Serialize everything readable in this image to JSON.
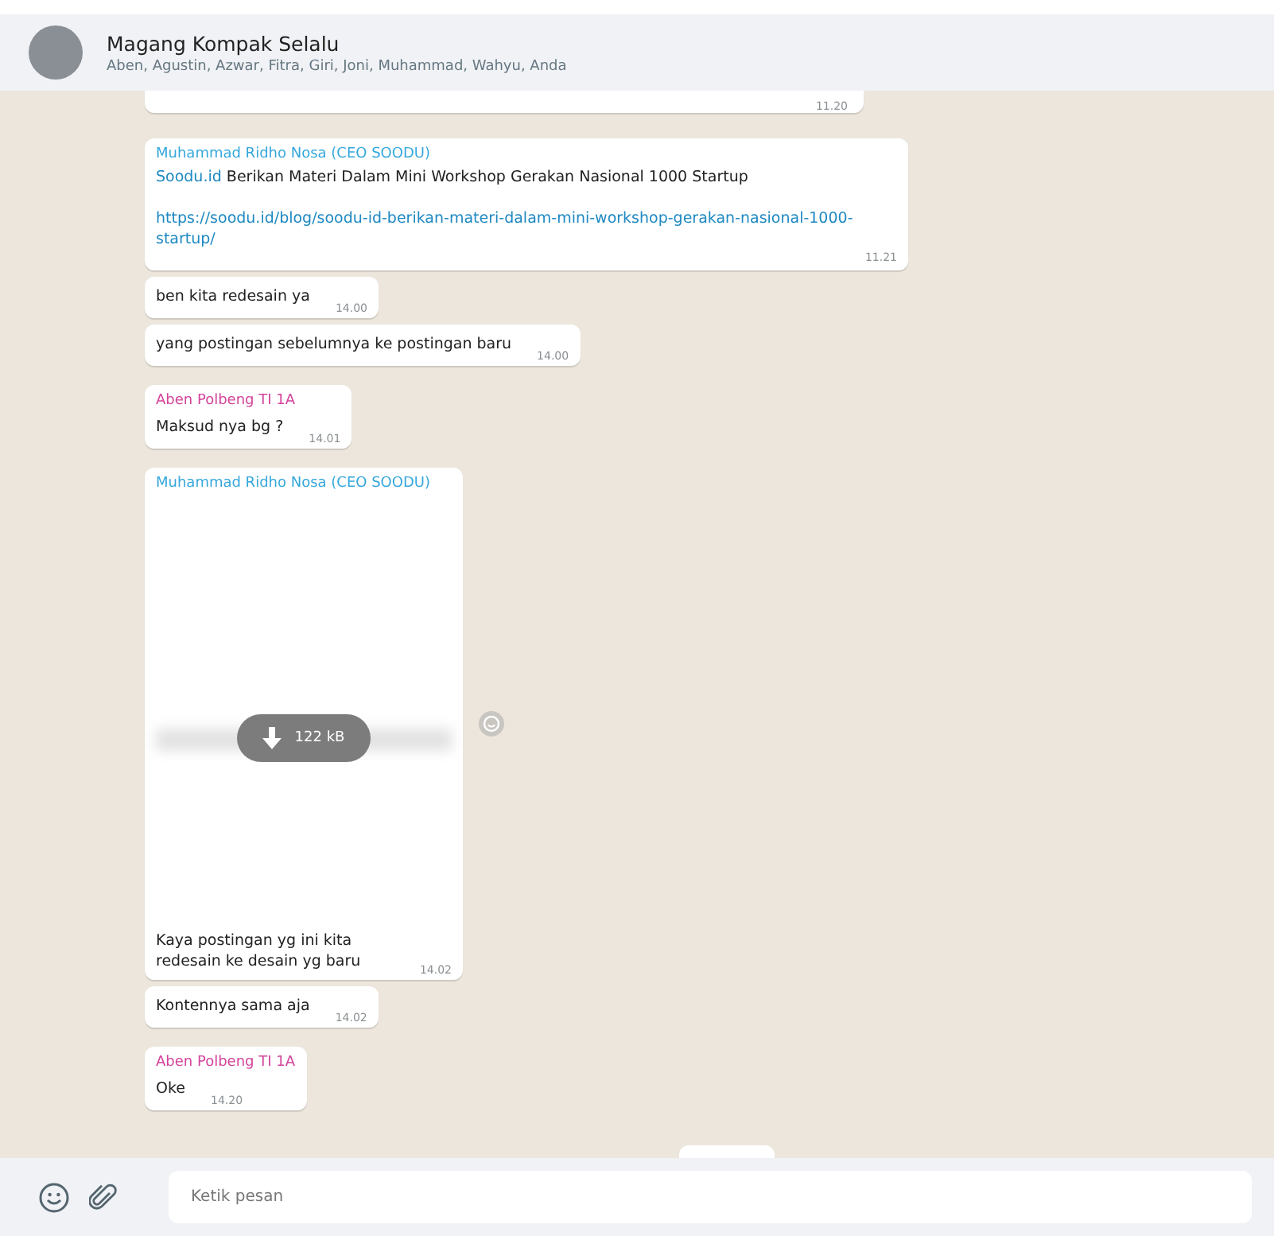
{
  "header": {
    "title": "Magang Kompak Selalu",
    "members": "Aben, Agustin, Azwar, Fitra, Giri, Joni, Muhammad, Wahyu, Anda"
  },
  "messages": [
    {
      "kind": "partial",
      "time": "11.20"
    },
    {
      "kind": "link",
      "sender": "Muhammad Ridho Nosa (CEO SOODU)",
      "color": "#35a7dc",
      "site": "Soodu.id",
      "text": "Berikan Materi Dalam Mini Workshop Gerakan Nasional 1000 Startup",
      "url": "https://soodu.id/blog/soodu-id-berikan-materi-dalam-mini-workshop-gerakan-nasional-1000-startup/",
      "time": "11.21"
    },
    {
      "kind": "text",
      "text": "ben kita redesain ya",
      "time": "14.00"
    },
    {
      "kind": "text",
      "text": "yang postingan sebelumnya ke postingan baru",
      "time": "14.00"
    },
    {
      "kind": "text",
      "sender": "Aben Polbeng TI 1A",
      "color": "#d3439a",
      "text": "Maksud nya bg ?",
      "time": "14.01"
    },
    {
      "kind": "document",
      "sender": "Muhammad Ridho Nosa (CEO SOODU)",
      "color": "#35a7dc",
      "size": "122 kB",
      "text": "Kaya postingan yg ini kita redesain ke desain yg baru",
      "time": "14.02"
    },
    {
      "kind": "text",
      "text": "Kontennya sama aja",
      "time": "14.02"
    },
    {
      "kind": "text",
      "sender": "Aben Polbeng TI 1A",
      "color": "#d3439a",
      "text": "Oke",
      "time": "14.20"
    }
  ],
  "composer": {
    "placeholder": "Ketik pesan"
  }
}
